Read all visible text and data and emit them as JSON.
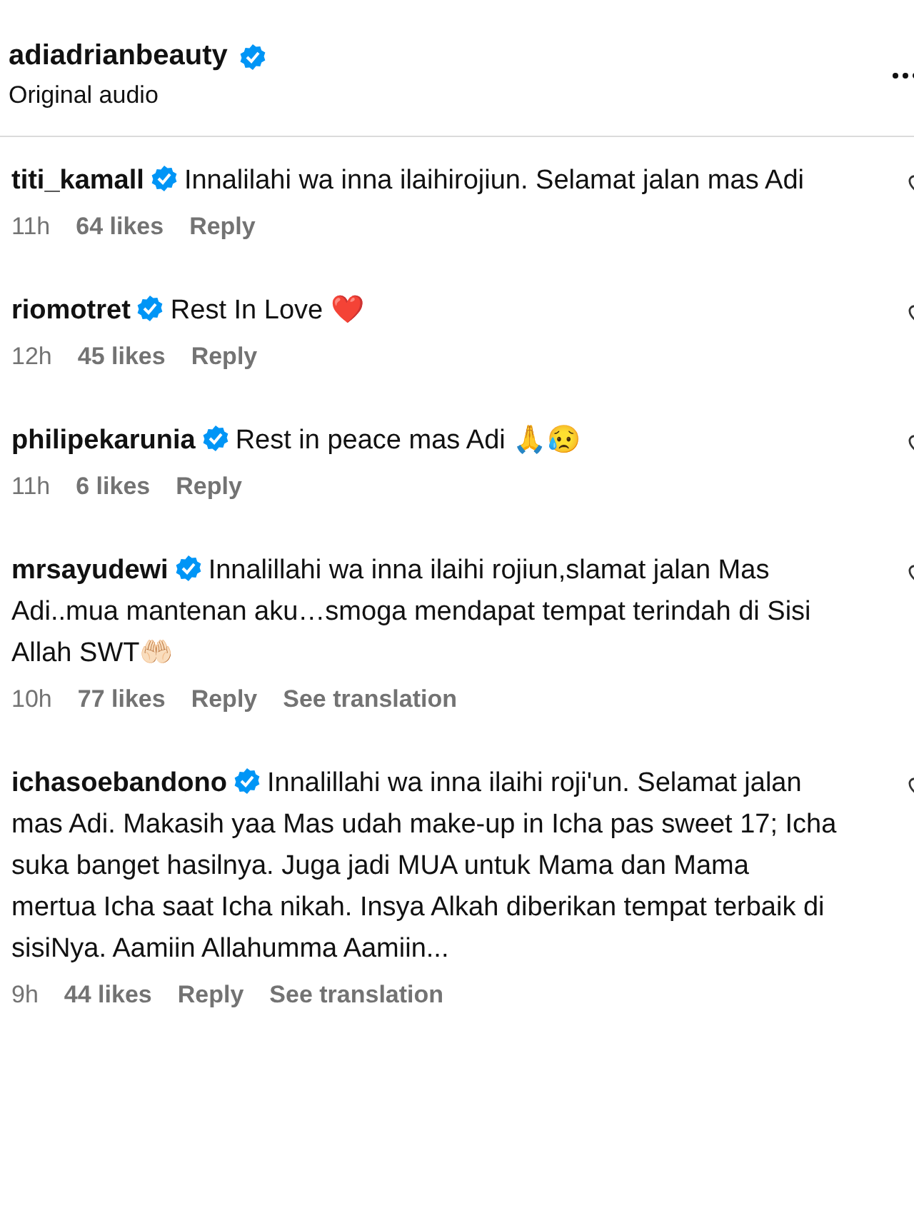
{
  "header": {
    "username": "adiadrianbeauty",
    "verified": true,
    "subtitle": "Original audio"
  },
  "comments": [
    {
      "username": "titi_kamall",
      "verified": true,
      "text": "Innalilahi wa inna ilaihirojiun. Selamat jalan mas Adi",
      "time": "11h",
      "likes": "64 likes",
      "actions": [
        "Reply"
      ]
    },
    {
      "username": "riomotret",
      "verified": true,
      "text": "Rest In Love ❤️",
      "time": "12h",
      "likes": "45 likes",
      "actions": [
        "Reply"
      ]
    },
    {
      "username": "philipekarunia",
      "verified": true,
      "text": "Rest in peace mas Adi 🙏😥",
      "time": "11h",
      "likes": "6 likes",
      "actions": [
        "Reply"
      ]
    },
    {
      "username": "mrsayudewi",
      "verified": true,
      "text": "Innalillahi wa inna ilaihi rojiun,slamat jalan Mas Adi..mua mantenan aku…smoga mendapat tempat terindah di Sisi Allah SWT🤲🏻",
      "time": "10h",
      "likes": "77 likes",
      "actions": [
        "Reply",
        "See translation"
      ]
    },
    {
      "username": "ichasoebandono",
      "verified": true,
      "text": "Innalillahi wa inna ilaihi roji'un. Selamat jalan mas Adi. Makasih yaa Mas udah make-up in Icha pas sweet 17; Icha suka banget hasilnya. Juga jadi MUA untuk Mama dan Mama mertua Icha saat Icha nikah. Insya Alkah diberikan tempat terbaik di sisiNya. Aamiin Allahumma Aamiin...",
      "time": "9h",
      "likes": "44 likes",
      "actions": [
        "Reply",
        "See translation"
      ]
    }
  ]
}
